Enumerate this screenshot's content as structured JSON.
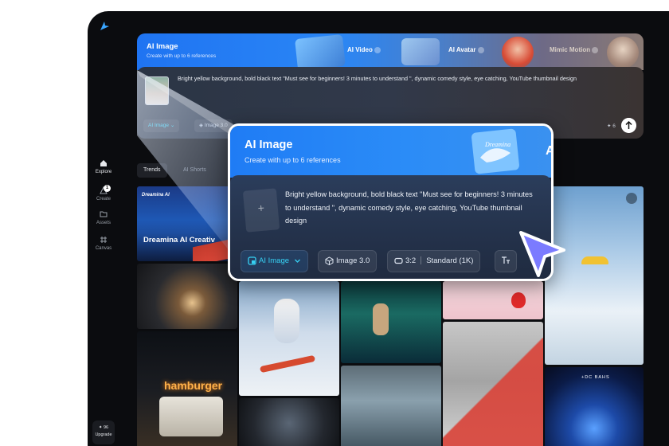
{
  "rail": {
    "items": [
      {
        "label": "Explore"
      },
      {
        "label": "Create",
        "badge": "1"
      },
      {
        "label": "Assets"
      },
      {
        "label": "Canvas"
      }
    ],
    "upgrade": {
      "credits": "✦ 96",
      "label": "Upgrade"
    }
  },
  "banner": {
    "title": "AI Image",
    "subtitle": "Create with up to 6 references",
    "tabs": [
      {
        "label": "AI Video"
      },
      {
        "label": "AI Avatar"
      },
      {
        "label": "Mimic Motion"
      }
    ]
  },
  "prompt": {
    "text": "Bright yellow background, bold black text \"Must see for beginners! 3 minutes to understand \", dynamic comedy style, eye catching, YouTube thumbnail design",
    "mode": "AI Image",
    "model": "Image 3.0",
    "credits": "✦ 6"
  },
  "filters": [
    {
      "label": "Trends"
    },
    {
      "label": "AI Shorts"
    }
  ],
  "gallery": {
    "brand": "Dreamina AI",
    "headline": "Dreamina AI Creativ",
    "sign": "hamburger",
    "poster": "+DC BAHS"
  },
  "popup": {
    "title": "AI Image",
    "subtitle": "Create with up to 6 references",
    "upload": "+",
    "prompt": "Bright yellow background, bold black text \"Must see for beginners! 3 minutes to understand \", dynamic comedy style, eye catching, YouTube thumbnail design",
    "mode": "AI Image",
    "model": "Image 3.0",
    "ratio": "3:2",
    "quality": "Standard (1K)",
    "art_letter": "A",
    "art_script": "Dreamina"
  },
  "colors": {
    "accent": "#1f7cf5",
    "cursor": "#7b7bff",
    "background": "#0b0c0f"
  }
}
